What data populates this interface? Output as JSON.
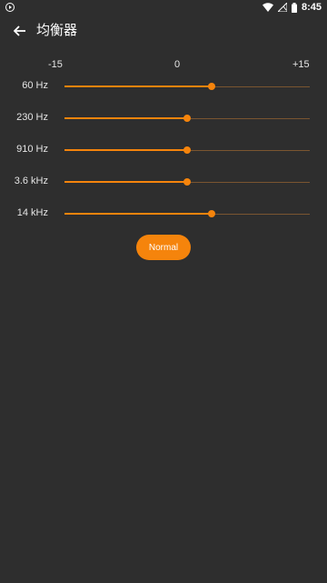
{
  "status_bar": {
    "time": "8:45",
    "icons": [
      "media-play-icon",
      "wifi-icon",
      "no-signal-icon",
      "battery-icon"
    ]
  },
  "toolbar": {
    "title": "均衡器",
    "back_icon": "arrow-left-icon"
  },
  "scale": {
    "min_label": "-15",
    "mid_label": "0",
    "max_label": "+15",
    "min": -15,
    "max": 15
  },
  "bands": [
    {
      "label": "60 Hz",
      "value": 3
    },
    {
      "label": "230 Hz",
      "value": 0
    },
    {
      "label": "910 Hz",
      "value": 0
    },
    {
      "label": "3.6 kHz",
      "value": 0
    },
    {
      "label": "14 kHz",
      "value": 3
    }
  ],
  "preset": {
    "label": "Normal"
  },
  "colors": {
    "background": "#2e2e2e",
    "accent": "#f5840c",
    "track": "#7a5530",
    "text": "#e6e6e6"
  }
}
